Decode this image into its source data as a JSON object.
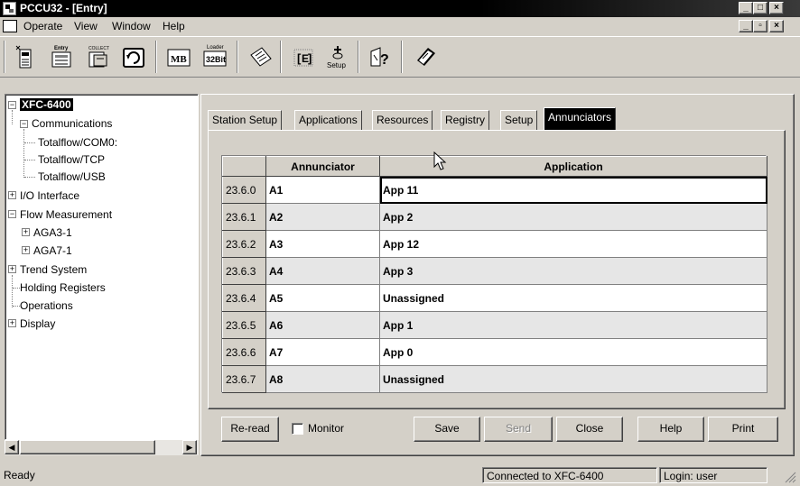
{
  "window": {
    "title": "PCCU32 - [Entry]",
    "controls": [
      "_",
      "□",
      "×"
    ]
  },
  "menu": {
    "items": [
      "Operate",
      "View",
      "Window",
      "Help"
    ],
    "mdi_controls": [
      "_",
      "▫",
      "×"
    ]
  },
  "toolbar": {
    "entry_label": "Entry",
    "collect_label": "COLLECT",
    "mb_label": "MB",
    "loader_label": "Loader",
    "bit_label": "32Bit",
    "setup_label": "Setup",
    "buttons": [
      "entry",
      "collect",
      "panel",
      "refresh",
      "modbus",
      "loader-32bit",
      "notes",
      "fcu-manager",
      "setup",
      "help-query",
      "book"
    ]
  },
  "tree": {
    "root": "XFC-6400",
    "nodes": [
      {
        "label": "Communications",
        "expander": "−"
      },
      {
        "label": "Totalflow/COM0:"
      },
      {
        "label": "Totalflow/TCP"
      },
      {
        "label": "Totalflow/USB"
      },
      {
        "label": "I/O Interface",
        "expander": "+"
      },
      {
        "label": "Flow Measurement",
        "expander": "−"
      },
      {
        "label": "AGA3-1",
        "expander": "+"
      },
      {
        "label": "AGA7-1",
        "expander": "+"
      },
      {
        "label": "Trend System",
        "expander": "+"
      },
      {
        "label": "Holding Registers"
      },
      {
        "label": "Operations"
      },
      {
        "label": "Display",
        "expander": "+"
      }
    ]
  },
  "tabs": [
    "Station Setup",
    "Applications",
    "Resources",
    "Registry",
    "Setup",
    "Annunciators"
  ],
  "active_tab": "Annunciators",
  "grid": {
    "columns": [
      "",
      "Annunciator",
      "Application"
    ],
    "rows": [
      {
        "reg": "23.6.0",
        "annunciator": "A1",
        "application": "App 11"
      },
      {
        "reg": "23.6.1",
        "annunciator": "A2",
        "application": "App 2"
      },
      {
        "reg": "23.6.2",
        "annunciator": "A3",
        "application": "App 12"
      },
      {
        "reg": "23.6.3",
        "annunciator": "A4",
        "application": "App 3"
      },
      {
        "reg": "23.6.4",
        "annunciator": "A5",
        "application": "Unassigned"
      },
      {
        "reg": "23.6.5",
        "annunciator": "A6",
        "application": "App 1"
      },
      {
        "reg": "23.6.6",
        "annunciator": "A7",
        "application": "App 0"
      },
      {
        "reg": "23.6.7",
        "annunciator": "A8",
        "application": "Unassigned"
      }
    ]
  },
  "buttons": {
    "reread": "Re-read",
    "monitor": "Monitor",
    "save": "Save",
    "send": "Send",
    "close": "Close",
    "help": "Help",
    "print": "Print"
  },
  "status": {
    "left": "Ready",
    "connection": "Connected to XFC-6400",
    "login": "Login: user"
  }
}
